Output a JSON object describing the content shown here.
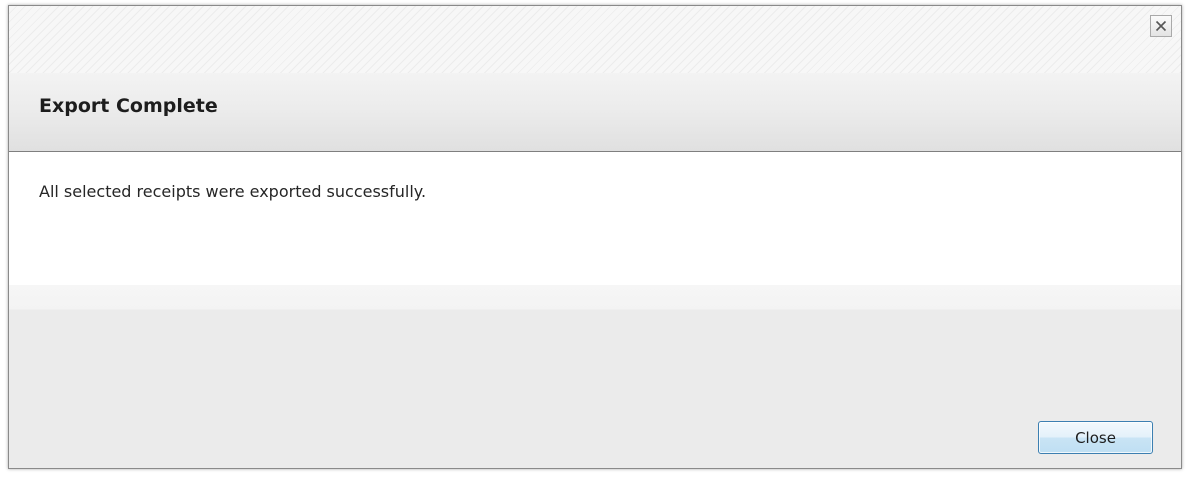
{
  "dialog": {
    "title": "Export Complete",
    "message": "All selected receipts were exported successfully.",
    "close_button_label": "Close",
    "close_icon": "close-x-icon"
  }
}
